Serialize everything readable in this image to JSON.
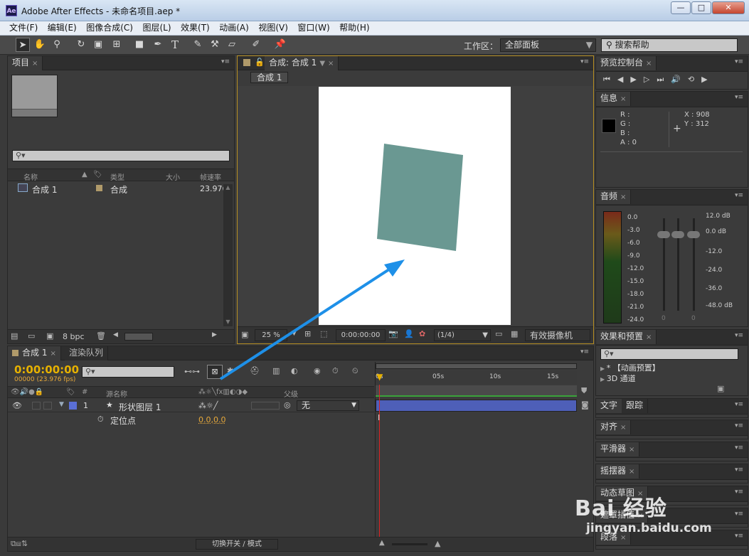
{
  "window": {
    "title": "Adobe After Effects - 未命名项目.aep *",
    "app_icon": "Ae",
    "min": "—",
    "max": "□",
    "close": "✕"
  },
  "menu": [
    "文件(F)",
    "编辑(E)",
    "图像合成(C)",
    "图层(L)",
    "效果(T)",
    "动画(A)",
    "视图(V)",
    "窗口(W)",
    "帮助(H)"
  ],
  "toolbar": {
    "workspace_label": "工作区：",
    "workspace_value": "全部面板",
    "search_help": "搜索帮助"
  },
  "project": {
    "tab": "项目",
    "columns": [
      "名称",
      "类型",
      "大小",
      "帧速率"
    ],
    "items": [
      {
        "name": "合成 1",
        "type": "合成",
        "fps": "23.976"
      }
    ],
    "bpc": "8 bpc"
  },
  "composition": {
    "tab": "合成: 合成 1",
    "subtab": "合成 1",
    "zoom": "25 %",
    "timecode": "0:00:00:00",
    "resolution": "(1/4)",
    "camera": "有效摄像机",
    "shape_color": "#6a9892"
  },
  "timeline": {
    "tabs": [
      "合成 1",
      "渲染队列"
    ],
    "current_time": "0:00:00:00",
    "frame_info": "00000 (23.976 fps)",
    "layer_header": "源名称",
    "parent_header": "父级",
    "layer": {
      "index": "1",
      "name": "形状图层 1",
      "parent": "无"
    },
    "property": {
      "name": "定位点",
      "value": "0.0,0.0"
    },
    "ruler": [
      "0s",
      "05s",
      "10s",
      "15s"
    ],
    "footer_toggle": "切换开关 / 模式"
  },
  "preview": {
    "tab": "预览控制台"
  },
  "info": {
    "tab": "信息",
    "r": "R :",
    "g": "G :",
    "b": "B :",
    "a": "A : 0",
    "x": "X : 908",
    "y": "Y : 312"
  },
  "audio": {
    "tab": "音频",
    "left_scale": [
      "0.0",
      "-3.0",
      "-6.0",
      "-9.0",
      "-12.0",
      "-15.0",
      "-18.0",
      "-21.0",
      "-24.0"
    ],
    "right_scale": [
      "12.0 dB",
      "0.0 dB",
      "-12.0",
      "-24.0",
      "-36.0",
      "-48.0 dB"
    ],
    "bottom_left": "0",
    "bottom_right": "0"
  },
  "effects": {
    "tab": "效果和预置",
    "items": [
      "* 【动画预置】",
      "3D 通道"
    ]
  },
  "right_panels": [
    "文字",
    "跟踪",
    "对齐",
    "平滑器",
    "摇摆器",
    "动态草图",
    "遮罩插值",
    "段落"
  ],
  "watermark": {
    "brand": "Bai  经验",
    "url": "jingyan.baidu.com"
  }
}
